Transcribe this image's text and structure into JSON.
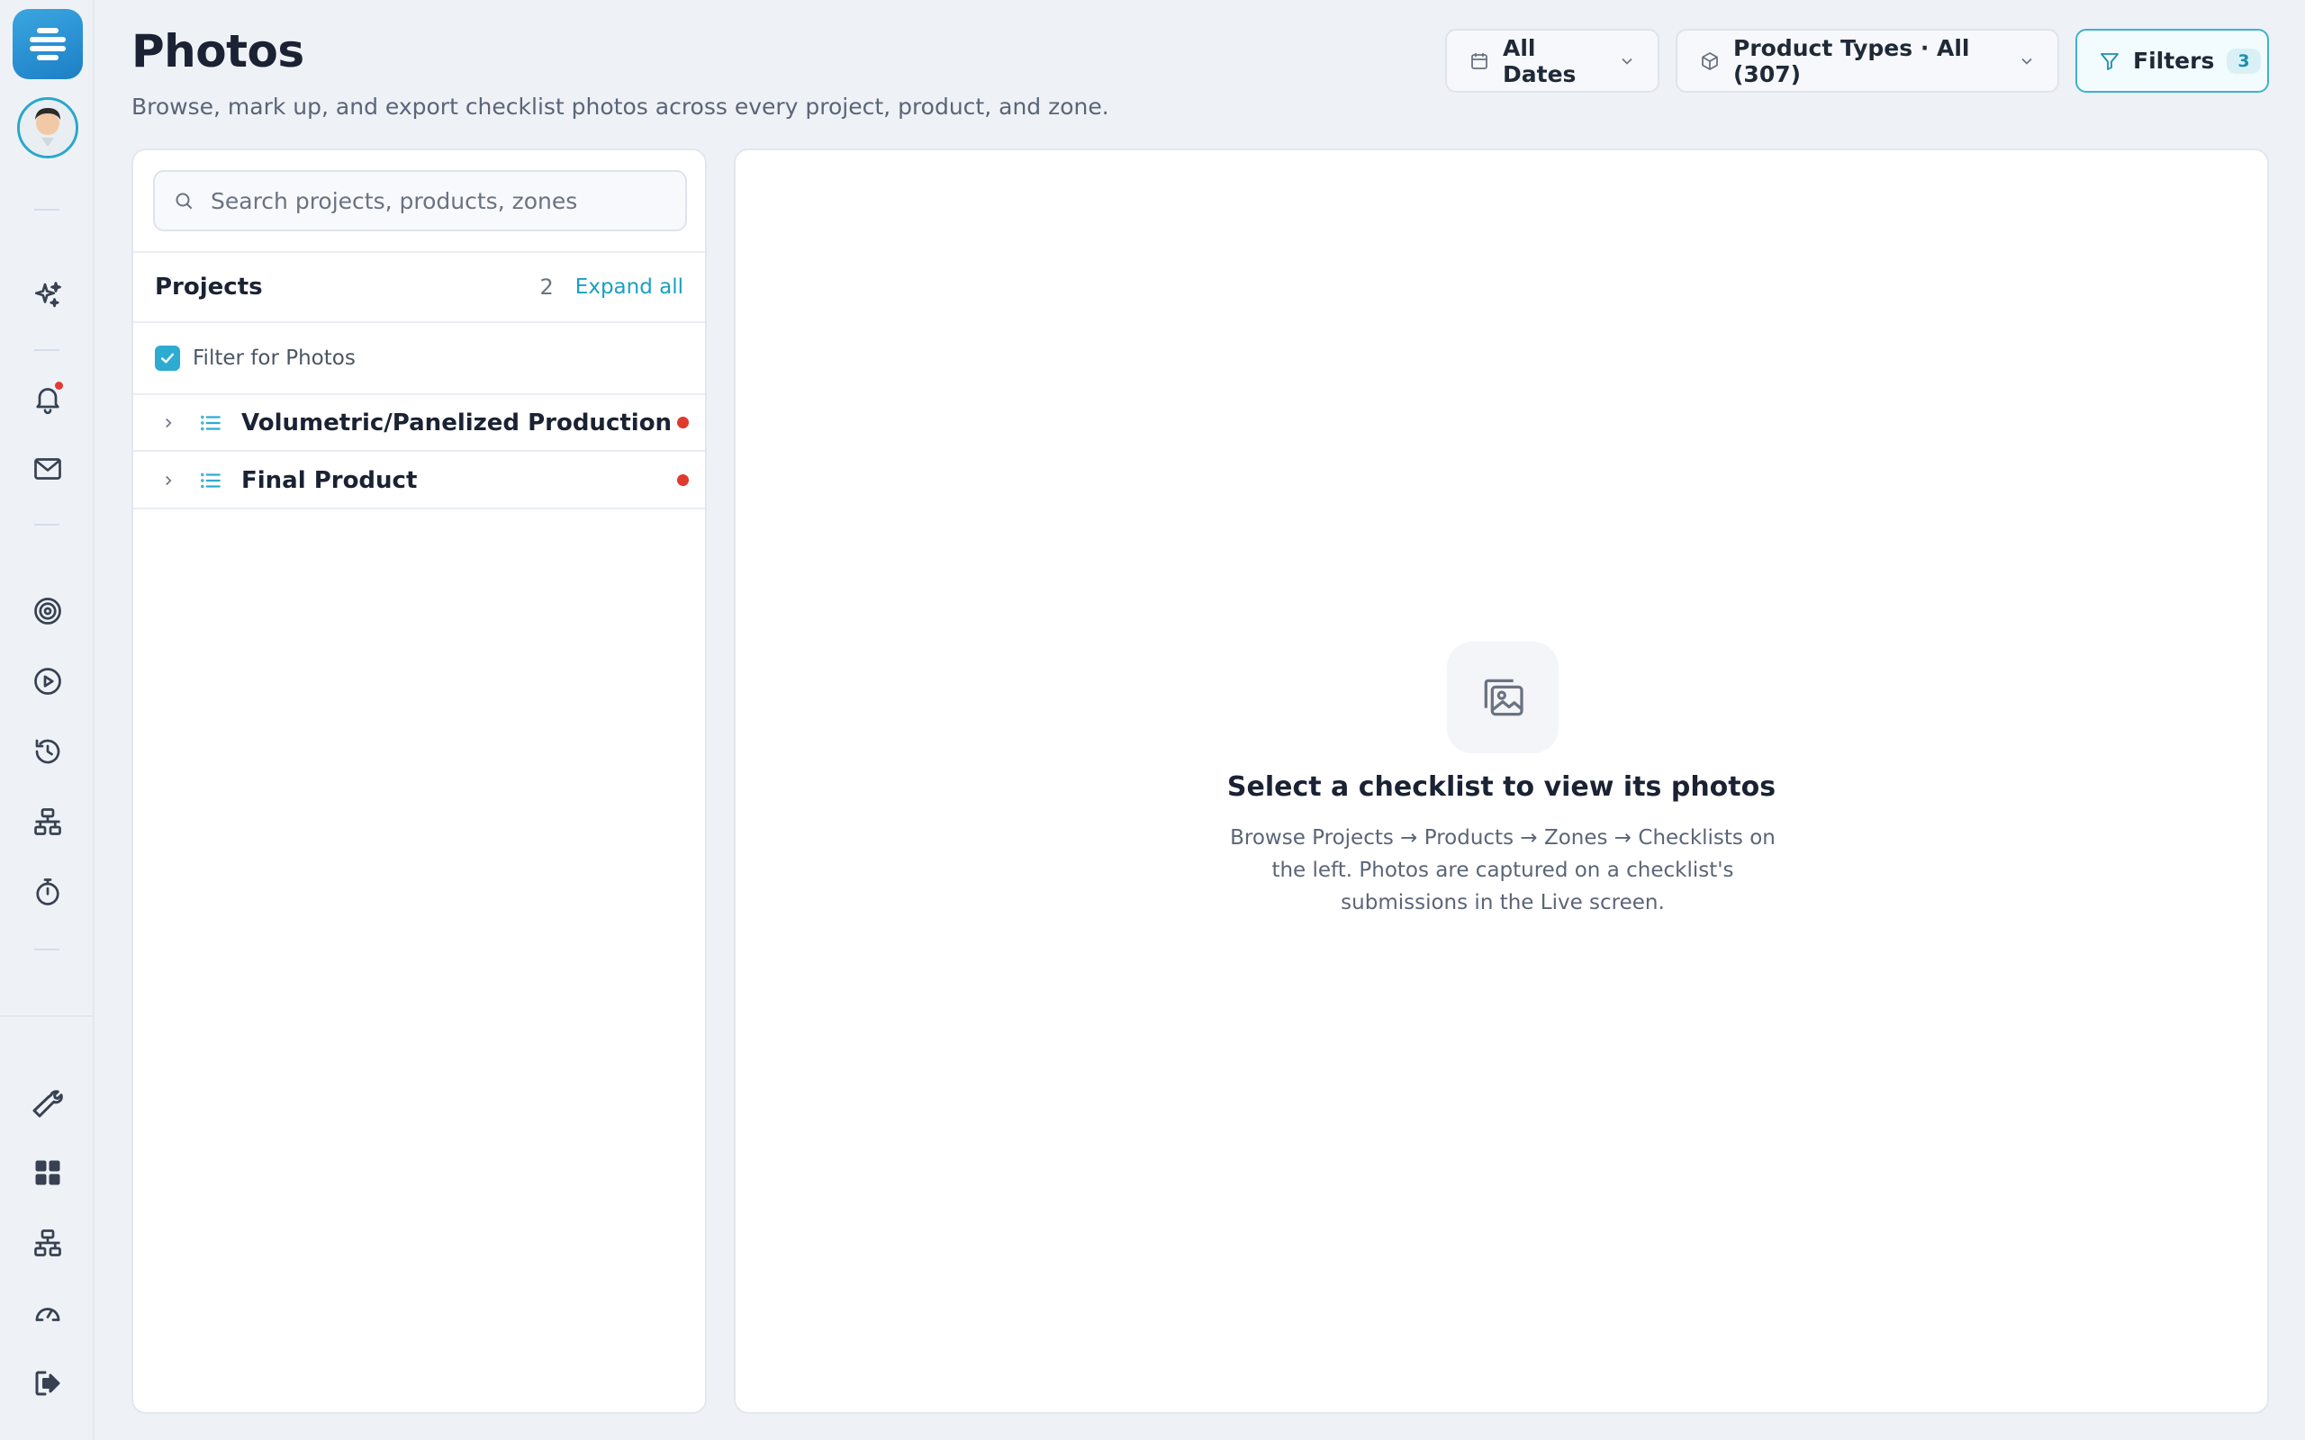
{
  "header": {
    "title": "Photos",
    "subtitle": "Browse, mark up, and export checklist photos across every project, product, and zone.",
    "dates_label": "All Dates",
    "product_types_label": "Product Types · All (307)",
    "filters_label": "Filters",
    "filters_count": "3"
  },
  "sidebar": {
    "icons": [
      "logo-icon",
      "avatar",
      "sparkles-icon",
      "bell-icon",
      "mail-icon",
      "target-icon",
      "play-icon",
      "history-icon",
      "hierarchy-icon",
      "stopwatch-icon",
      "wrench-icon",
      "dashboard-icon",
      "network-icon",
      "gauge-icon",
      "logout-icon"
    ]
  },
  "left_panel": {
    "search_placeholder": "Search projects, products, zones",
    "projects_title": "Projects",
    "projects_count": "2",
    "expand_all": "Expand all",
    "filter_label": "Filter for Photos",
    "filter_checked": true,
    "projects": [
      {
        "label": "Volumetric/Panelized Production",
        "status_color": "#e0392d"
      },
      {
        "label": "Final Product",
        "status_color": "#e0392d"
      }
    ]
  },
  "empty_state": {
    "title": "Select a checklist to view its photos",
    "description": "Browse Projects → Products → Zones → Checklists on the left. Photos are captured on a checklist's submissions in the Live screen."
  },
  "colors": {
    "accent": "#2eabd0",
    "status_dot": "#e0392d",
    "background": "#eef2f7"
  }
}
